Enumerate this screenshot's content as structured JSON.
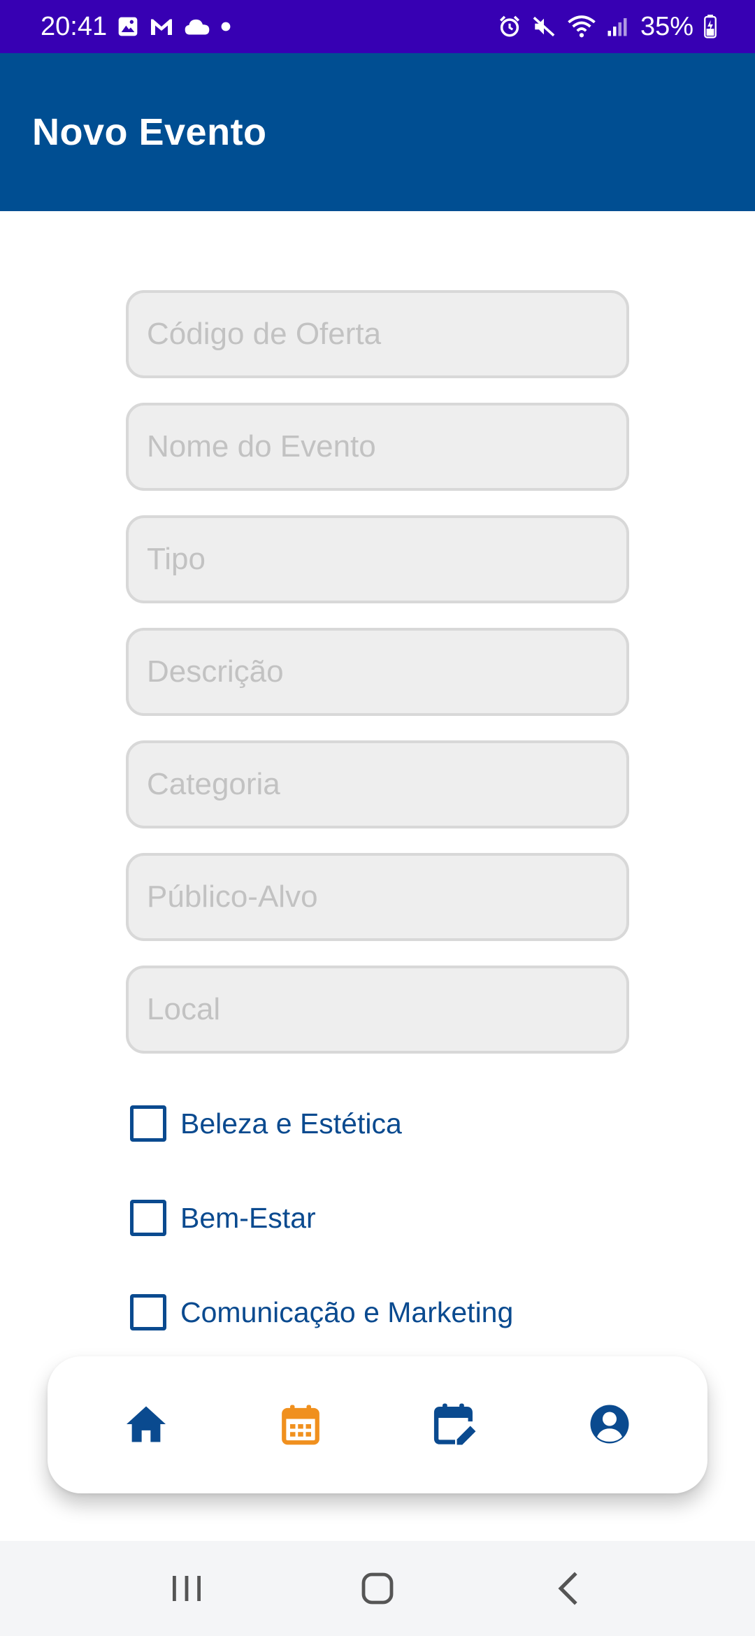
{
  "status_bar": {
    "time": "20:41",
    "battery": "35%",
    "left_icons": [
      "image-icon",
      "gmail-icon",
      "cloud-icon",
      "dot-icon"
    ],
    "right_icons": [
      "alarm-icon",
      "mute-icon",
      "wifi-icon",
      "signal-icon",
      "battery-icon"
    ]
  },
  "app_bar": {
    "title": "Novo Evento",
    "color": "#004e92"
  },
  "form": {
    "fields": [
      {
        "placeholder": "Código de Oferta",
        "value": ""
      },
      {
        "placeholder": "Nome do Evento",
        "value": ""
      },
      {
        "placeholder": "Tipo",
        "value": ""
      },
      {
        "placeholder": "Descrição",
        "value": ""
      },
      {
        "placeholder": "Categoria",
        "value": ""
      },
      {
        "placeholder": "Público-Alvo",
        "value": ""
      },
      {
        "placeholder": "Local",
        "value": ""
      }
    ],
    "checkboxes": [
      {
        "label": "Beleza e Estética",
        "checked": false
      },
      {
        "label": "Bem-Estar",
        "checked": false
      },
      {
        "label": "Comunicação e Marketing",
        "checked": false
      }
    ]
  },
  "bottom_nav": {
    "items": [
      {
        "icon": "home-icon",
        "active": false
      },
      {
        "icon": "calendar-icon",
        "active": true
      },
      {
        "icon": "calendar-edit-icon",
        "active": false
      },
      {
        "icon": "account-icon",
        "active": false
      }
    ],
    "active_color": "#f0901e",
    "inactive_color": "#0a4a8f"
  },
  "system_nav": {
    "items": [
      "recents-icon",
      "home-circle-icon",
      "back-icon"
    ]
  }
}
